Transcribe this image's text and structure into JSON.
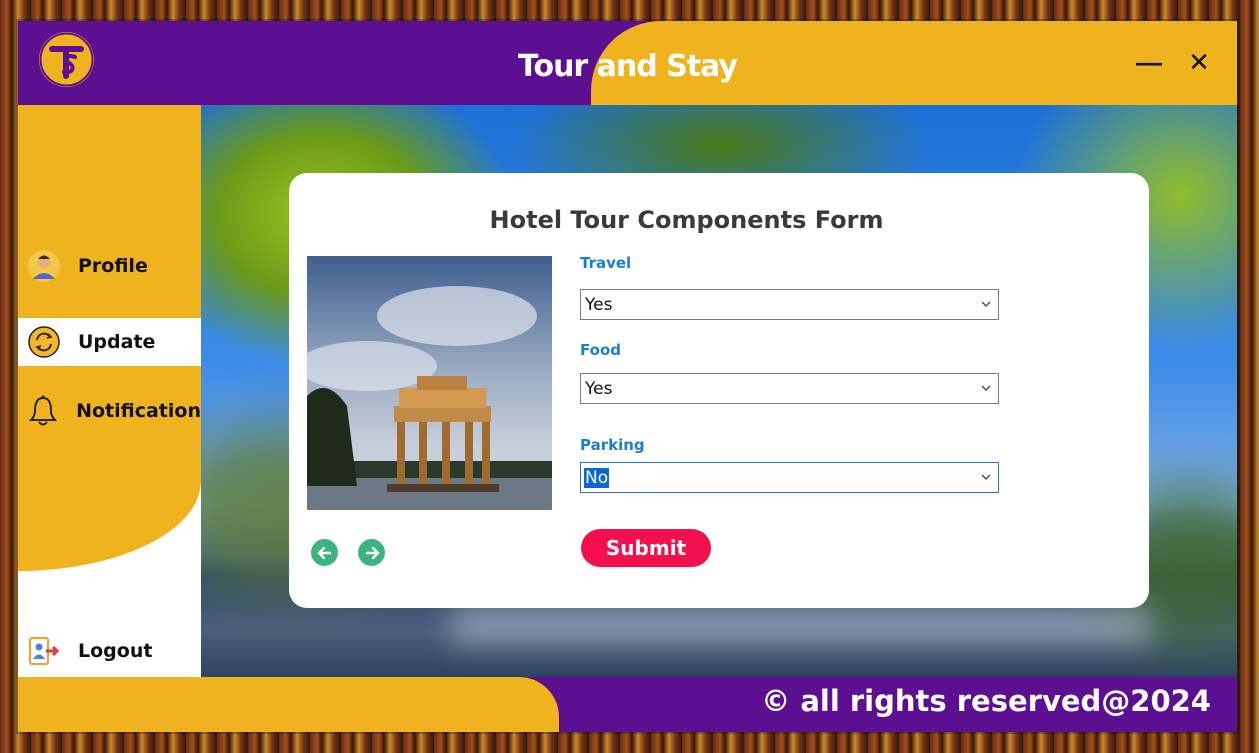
{
  "app": {
    "title": "Tour and Stay",
    "minimize_glyph": "—",
    "close_glyph": "✕"
  },
  "sidebar": {
    "items": [
      {
        "label": "Profile",
        "icon": "user-avatar-icon",
        "active": false
      },
      {
        "label": "Update",
        "icon": "refresh-icon",
        "active": true
      },
      {
        "label": "Notification",
        "icon": "bell-icon",
        "active": false
      }
    ],
    "logout": {
      "label": "Logout",
      "icon": "logout-icon"
    }
  },
  "form": {
    "title": "Hotel Tour Components Form",
    "fields": [
      {
        "label": "Travel",
        "value": "Yes"
      },
      {
        "label": "Food",
        "value": "Yes"
      },
      {
        "label": "Parking",
        "value": "No"
      }
    ],
    "submit_label": "Submit"
  },
  "footer": {
    "text": "© all rights reserved@2024"
  },
  "colors": {
    "purple": "#5d0f91",
    "gold": "#efb320",
    "submit": "#f2104f",
    "label_blue": "#1b7fd0",
    "arrow_green": "#3bb47e"
  }
}
